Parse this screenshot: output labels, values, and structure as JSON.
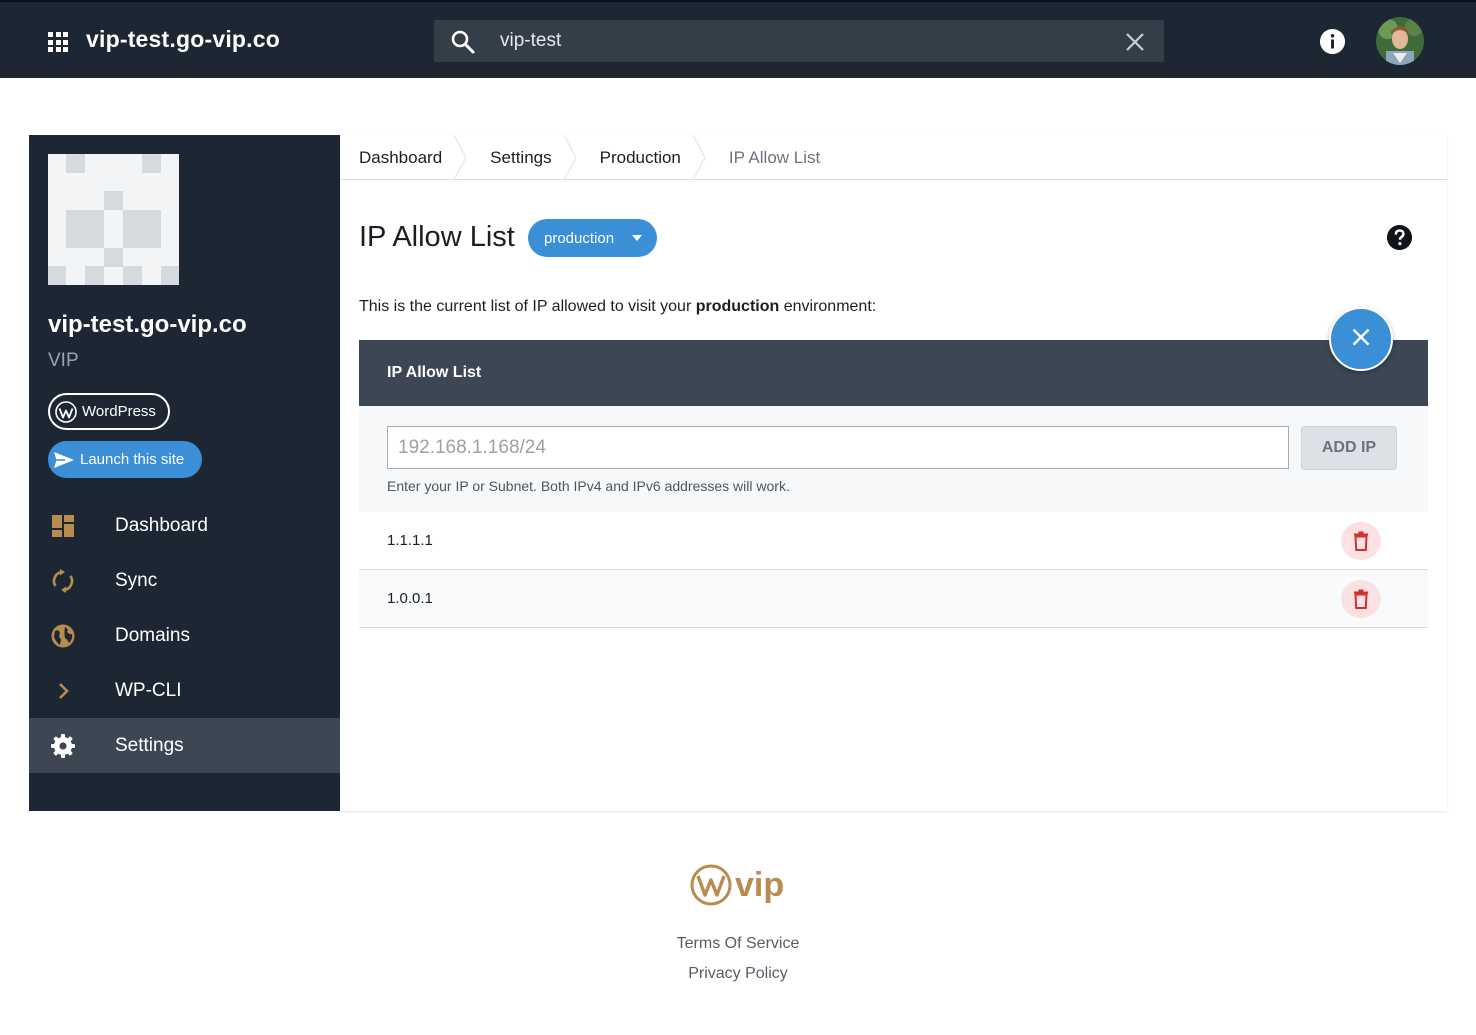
{
  "topbar": {
    "app_title": "vip-test.go-vip.co",
    "search": {
      "value": "vip-test",
      "placeholder": "Search"
    },
    "icons": [
      "apps-icon",
      "search-icon",
      "clear-icon",
      "info-icon",
      "avatar"
    ]
  },
  "sidebar": {
    "site_name": "vip-test.go-vip.co",
    "tier": "VIP",
    "platform_label": "WordPress",
    "launch_label": "Launch this site",
    "items": [
      {
        "label": "Dashboard",
        "icon": "dashboard-icon",
        "active": false
      },
      {
        "label": "Sync",
        "icon": "sync-icon",
        "active": false
      },
      {
        "label": "Domains",
        "icon": "globe-icon",
        "active": false
      },
      {
        "label": "WP-CLI",
        "icon": "chevron-right-icon",
        "active": false
      },
      {
        "label": "Settings",
        "icon": "gear-icon",
        "active": true
      }
    ]
  },
  "breadcrumb": [
    "Dashboard",
    "Settings",
    "Production",
    "IP Allow List"
  ],
  "main": {
    "title": "IP Allow List",
    "environment": "production",
    "intro_prefix": "This is the current list of IP allowed to visit your ",
    "intro_bold": "production",
    "intro_suffix": " environment:",
    "list_header": "IP Allow List",
    "input_placeholder": "192.168.1.168/24",
    "add_label": "ADD IP",
    "helper": "Enter your IP or Subnet. Both IPv4 and IPv6 addresses will work.",
    "ips": [
      "1.1.1.1",
      "1.0.0.1"
    ]
  },
  "footer": {
    "logo_text": "vip",
    "terms": "Terms Of Service",
    "privacy": "Privacy Policy"
  },
  "colors": {
    "topbar": "#1d2733",
    "accent": "#3a8fd6",
    "gold": "#b98b4e",
    "danger": "#d32f2f"
  }
}
